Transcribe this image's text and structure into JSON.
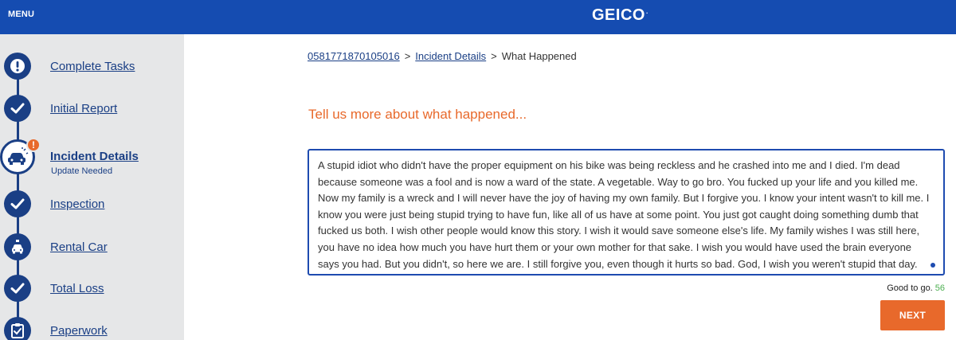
{
  "header": {
    "menu_label": "MENU",
    "logo_text": "GEICO",
    "logo_mark": "."
  },
  "sidebar": {
    "items": [
      {
        "label": "Complete Tasks",
        "icon": "exclamation-icon",
        "status": "alert"
      },
      {
        "label": "Initial Report",
        "icon": "check-icon",
        "status": "done"
      },
      {
        "label": "Incident Details",
        "sublabel": "Update Needed",
        "icon": "car-crash-icon",
        "status": "active",
        "badge": "!"
      },
      {
        "label": "Inspection",
        "icon": "check-icon",
        "status": "done"
      },
      {
        "label": "Rental Car",
        "icon": "rental-car-icon",
        "status": "pending"
      },
      {
        "label": "Total Loss",
        "icon": "check-icon",
        "status": "done"
      },
      {
        "label": "Paperwork",
        "icon": "clipboard-check-icon",
        "status": "pending"
      }
    ]
  },
  "breadcrumb": {
    "claim_number": "0581771870105016",
    "section": "Incident Details",
    "current": "What Happened",
    "separator": ">"
  },
  "main": {
    "heading": "Tell us more about what happened...",
    "story_text": "A stupid idiot who didn't have the proper equipment on his bike was being reckless and he crashed into me and I died.  I'm dead because someone was a fool and is now a ward of the state.  A vegetable.  Way to go bro.  You fucked up your life and you killed me.  Now my family is a wreck and I will never have the joy of having my own family.  But I forgive you.  I know your intent wasn't to kill me.  I know you were just being stupid trying to have fun, like all of us have at some point.  You just got caught doing something dumb that fucked us both.  I wish other people would know this story.  I wish it would save someone else's life.  My family wishes I was still here, you have no idea how much you have hurt them or your own mother for that sake.  I wish you would have used the brain everyone says you had.  But you didn't, so here we are.  I still forgive you, even though it hurts so bad.  God, I wish you weren't stupid that day.",
    "counter_label": "Good to go.",
    "counter_value": "56",
    "next_label": "NEXT"
  },
  "colors": {
    "header_blue": "#154cb1",
    "navy": "#1a3f85",
    "accent_orange": "#e8692b",
    "sidebar_bg": "#e6e7e8",
    "counter_green": "#4caf50"
  }
}
